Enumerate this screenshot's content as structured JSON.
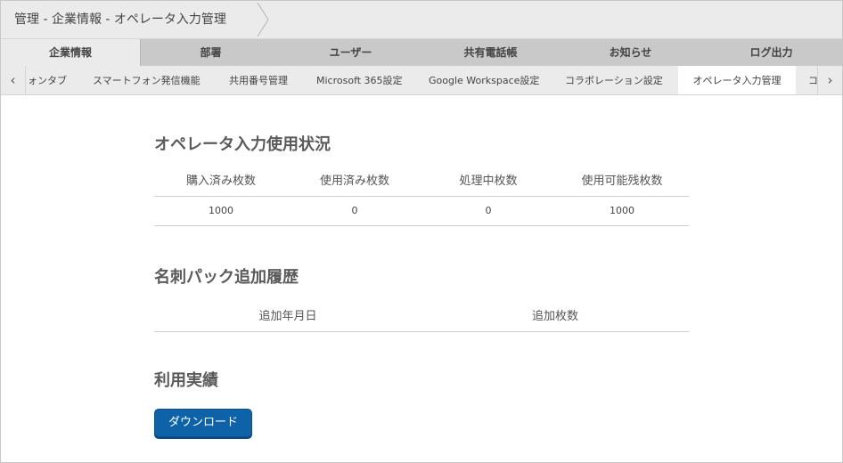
{
  "breadcrumb": {
    "text": "管理 - 企業情報 - オペレータ入力管理"
  },
  "main_tabs": [
    {
      "label": "企業情報",
      "active": true
    },
    {
      "label": "部署",
      "active": false
    },
    {
      "label": "ユーザー",
      "active": false
    },
    {
      "label": "共有電話帳",
      "active": false
    },
    {
      "label": "お知らせ",
      "active": false
    },
    {
      "label": "ログ出力",
      "active": false
    }
  ],
  "sub_tabs": {
    "prev_icon": "chevron-left-icon",
    "next_icon": "chevron-right-icon",
    "prev_glyph": "‹",
    "next_glyph": "›",
    "items": [
      {
        "label": "ォンタブ",
        "active": false
      },
      {
        "label": "スマートフォン発信機能",
        "active": false
      },
      {
        "label": "共用番号管理",
        "active": false
      },
      {
        "label": "Microsoft 365設定",
        "active": false
      },
      {
        "label": "Google Workspace設定",
        "active": false
      },
      {
        "label": "コラボレーション設定",
        "active": false
      },
      {
        "label": "オペレータ入力管理",
        "active": true
      },
      {
        "label": "コ",
        "active": false
      }
    ]
  },
  "usage": {
    "title": "オペレータ入力使用状況",
    "headers": [
      "購入済み枚数",
      "使用済み枚数",
      "処理中枚数",
      "使用可能残枚数"
    ],
    "values": [
      "1000",
      "0",
      "0",
      "1000"
    ]
  },
  "history": {
    "title": "名刺パック追加履歴",
    "headers": [
      "追加年月日",
      "追加枚数"
    ]
  },
  "results": {
    "title": "利用実績",
    "download_label": "ダウンロード"
  },
  "colors": {
    "accent": "#0e62a8",
    "tab_bar": "#c9c9c9",
    "header_bg": "#ebebeb"
  }
}
